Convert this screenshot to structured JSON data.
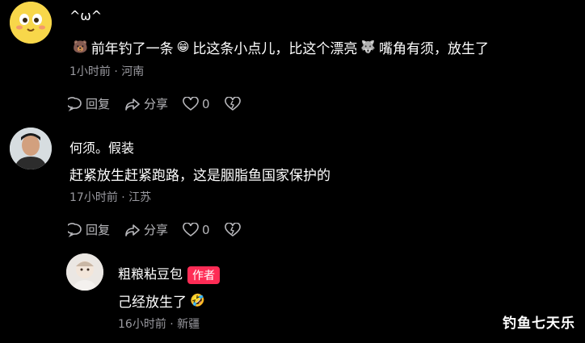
{
  "comments": [
    {
      "username": "^ω^",
      "text_parts": [
        "前年钓了一条",
        "比这条小点儿，比这个漂亮",
        "嘴角有须，放生了"
      ],
      "emojis": [
        "bear-face-emoji",
        "grin-face-emoji",
        "wolf-face-emoji"
      ],
      "meta": "1小时前 · 河南",
      "reply_label": "回复",
      "share_label": "分享",
      "like_count": "0"
    },
    {
      "username": "何须。假装",
      "text": "赶紧放生赶紧跑路，这是胭脂鱼国家保护的",
      "meta": "17小时前 · 江苏",
      "reply_label": "回复",
      "share_label": "分享",
      "like_count": "0"
    },
    {
      "username": "粗粮粘豆包",
      "author_badge": "作者",
      "text": "己经放生了",
      "emoji": "rofl-face-emoji",
      "meta": "16小时前 · 新疆"
    }
  ],
  "watermark": "钓鱼七天乐",
  "colors": {
    "background": "#000000",
    "meta": "#9a9aa0",
    "badge": "#fe2c55"
  }
}
